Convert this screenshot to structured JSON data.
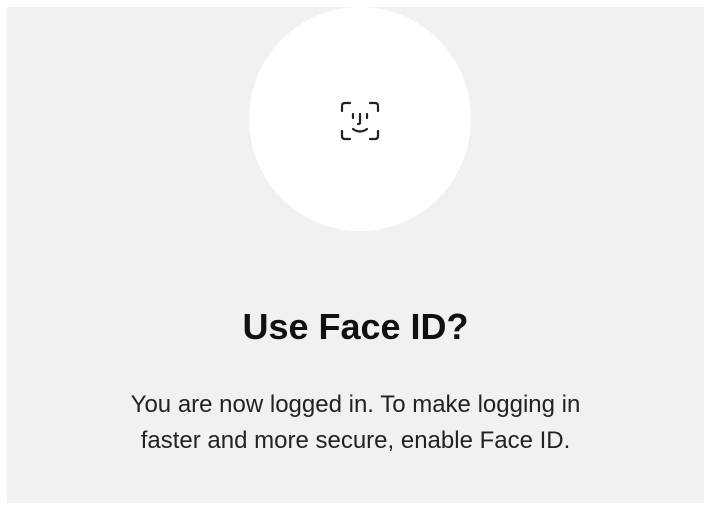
{
  "dialog": {
    "icon": "face-id-icon",
    "title": "Use Face ID?",
    "message_line1": "You are now logged in. To make logging in",
    "message_line2": "faster and more secure, enable Face ID."
  },
  "colors": {
    "panel_background": "#f1f1f1",
    "circle_background": "#ffffff",
    "text": "#111111"
  }
}
